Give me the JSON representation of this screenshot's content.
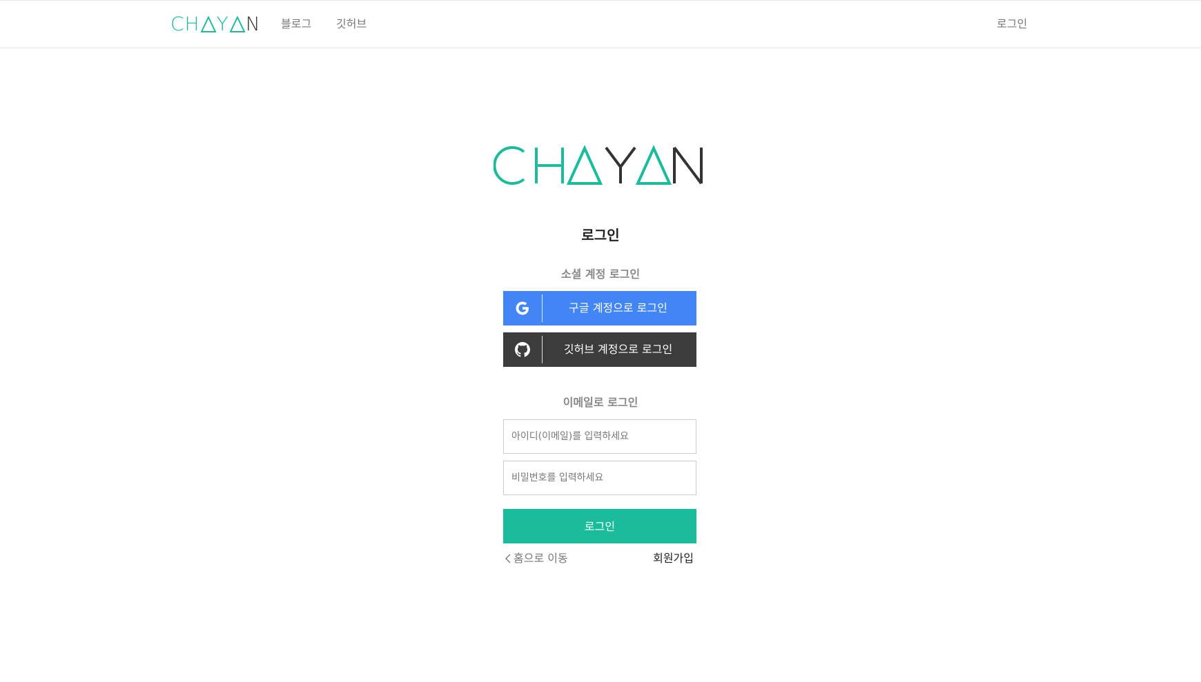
{
  "brand": {
    "logo_parts": [
      "CH",
      "Y",
      "N"
    ],
    "primary_color": "#1abc9c",
    "dark_color": "#333333"
  },
  "navbar": {
    "items": [
      {
        "label": "블로그"
      },
      {
        "label": "깃허브"
      }
    ],
    "login_label": "로그인"
  },
  "main": {
    "title": "로그인",
    "social_section_label": "소셜 계정 로그인",
    "google_button": {
      "label": "구글 계정으로 로그인",
      "color": "#4285f4",
      "icon": "google-icon"
    },
    "github_button": {
      "label": "깃허브 계정으로 로그인",
      "color": "#3c3c3c",
      "icon": "github-icon"
    },
    "email_section_label": "이메일로 로그인",
    "id_input": {
      "placeholder": "아이디(이메일)를 입력하세요",
      "value": ""
    },
    "password_input": {
      "placeholder": "비밀번호를 입력하세요",
      "value": ""
    },
    "submit_label": "로그인",
    "home_link": "홈으로 이동",
    "signup_link": "회원가입"
  }
}
